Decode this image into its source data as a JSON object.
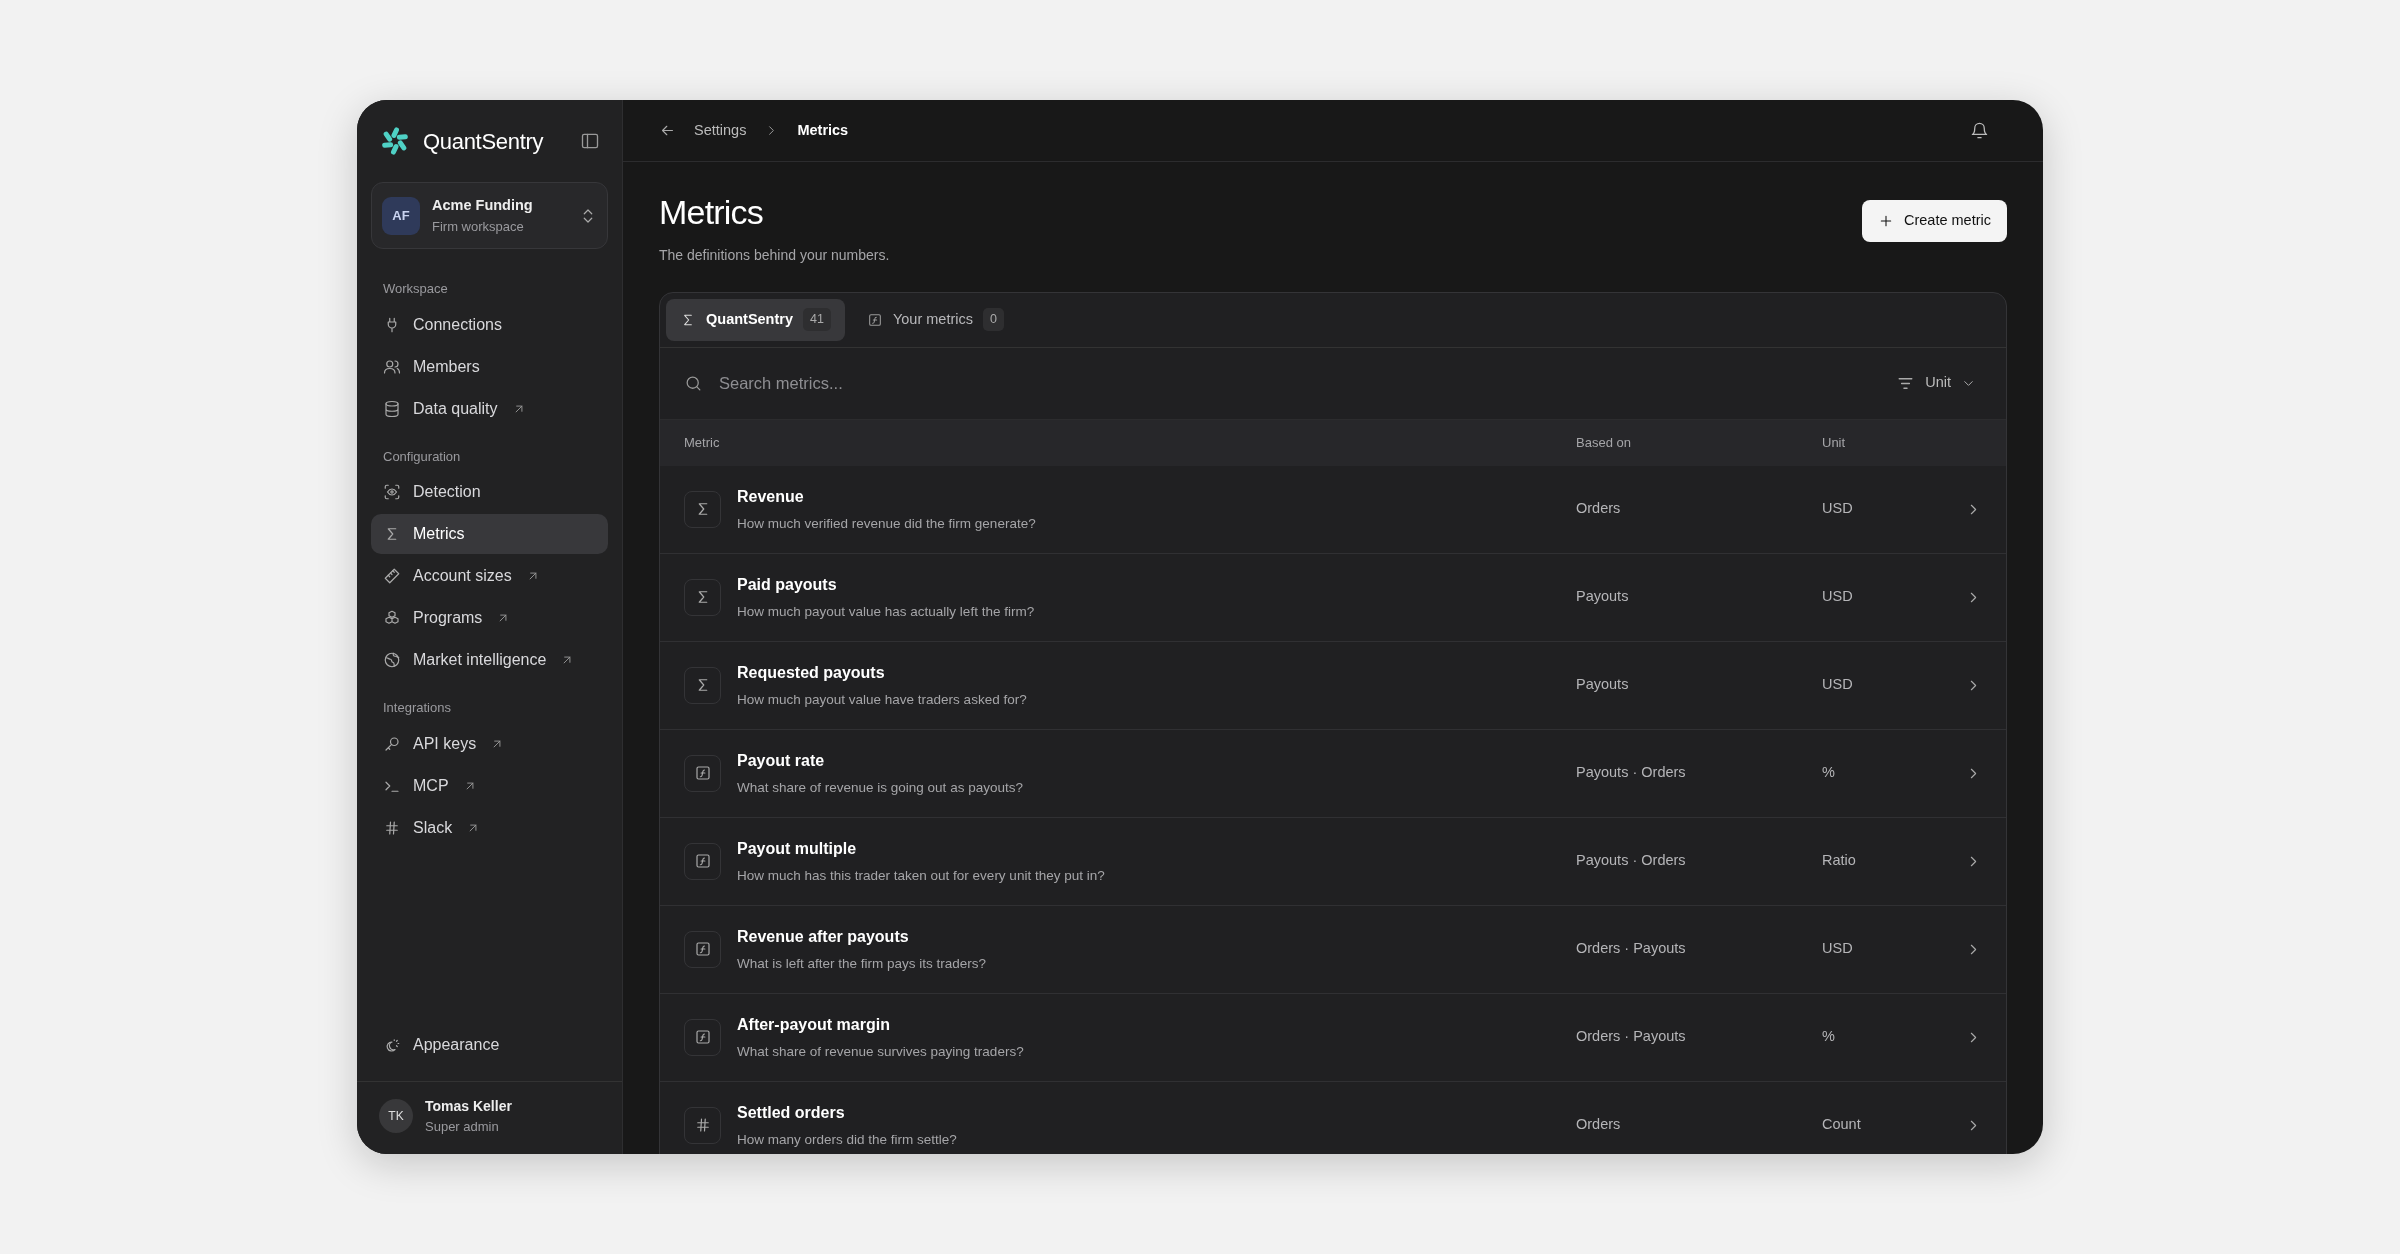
{
  "brand": "QuantSentry",
  "workspace": {
    "initials": "AF",
    "name": "Acme Funding",
    "subtitle": "Firm workspace"
  },
  "sidebar": {
    "sections": [
      {
        "label": "Workspace",
        "items": [
          {
            "label": "Connections",
            "selected": false,
            "external": false
          },
          {
            "label": "Members",
            "selected": false,
            "external": false
          },
          {
            "label": "Data quality",
            "selected": false,
            "external": true
          }
        ]
      },
      {
        "label": "Configuration",
        "items": [
          {
            "label": "Detection",
            "selected": false,
            "external": false
          },
          {
            "label": "Metrics",
            "selected": true,
            "external": false
          },
          {
            "label": "Account sizes",
            "selected": false,
            "external": true
          },
          {
            "label": "Programs",
            "selected": false,
            "external": true
          },
          {
            "label": "Market intelligence",
            "selected": false,
            "external": true
          }
        ]
      },
      {
        "label": "Integrations",
        "items": [
          {
            "label": "API keys",
            "selected": false,
            "external": true
          },
          {
            "label": "MCP",
            "selected": false,
            "external": true
          },
          {
            "label": "Slack",
            "selected": false,
            "external": true
          }
        ]
      }
    ],
    "bottom_item": "Appearance"
  },
  "user": {
    "initials": "TK",
    "name": "Tomas Keller",
    "role": "Super admin"
  },
  "breadcrumb": [
    "Settings",
    "Metrics"
  ],
  "page": {
    "title": "Metrics",
    "subtitle": "The definitions behind your numbers.",
    "create_button": "Create metric"
  },
  "tabs": [
    {
      "label": "QuantSentry",
      "count": "41",
      "selected": true
    },
    {
      "label": "Your metrics",
      "count": "0",
      "selected": false
    }
  ],
  "search": {
    "placeholder": "Search metrics..."
  },
  "filter": {
    "label": "Unit"
  },
  "table": {
    "columns": [
      "Metric",
      "Based on",
      "Unit"
    ],
    "rows": [
      {
        "kind": "sum",
        "name": "Revenue",
        "description": "How much verified revenue did the firm generate?",
        "based_on": "Orders",
        "unit": "USD"
      },
      {
        "kind": "sum",
        "name": "Paid payouts",
        "description": "How much payout value has actually left the firm?",
        "based_on": "Payouts",
        "unit": "USD"
      },
      {
        "kind": "sum",
        "name": "Requested payouts",
        "description": "How much payout value have traders asked for?",
        "based_on": "Payouts",
        "unit": "USD"
      },
      {
        "kind": "formula",
        "name": "Payout rate",
        "description": "What share of revenue is going out as payouts?",
        "based_on": "Payouts · Orders",
        "unit": "%"
      },
      {
        "kind": "formula",
        "name": "Payout multiple",
        "description": "How much has this trader taken out for every unit they put in?",
        "based_on": "Payouts · Orders",
        "unit": "Ratio"
      },
      {
        "kind": "formula",
        "name": "Revenue after payouts",
        "description": "What is left after the firm pays its traders?",
        "based_on": "Orders · Payouts",
        "unit": "USD"
      },
      {
        "kind": "formula",
        "name": "After-payout margin",
        "description": "What share of revenue survives paying traders?",
        "based_on": "Orders · Payouts",
        "unit": "%"
      },
      {
        "kind": "count",
        "name": "Settled orders",
        "description": "How many orders did the firm settle?",
        "based_on": "Orders",
        "unit": "Count"
      }
    ]
  }
}
